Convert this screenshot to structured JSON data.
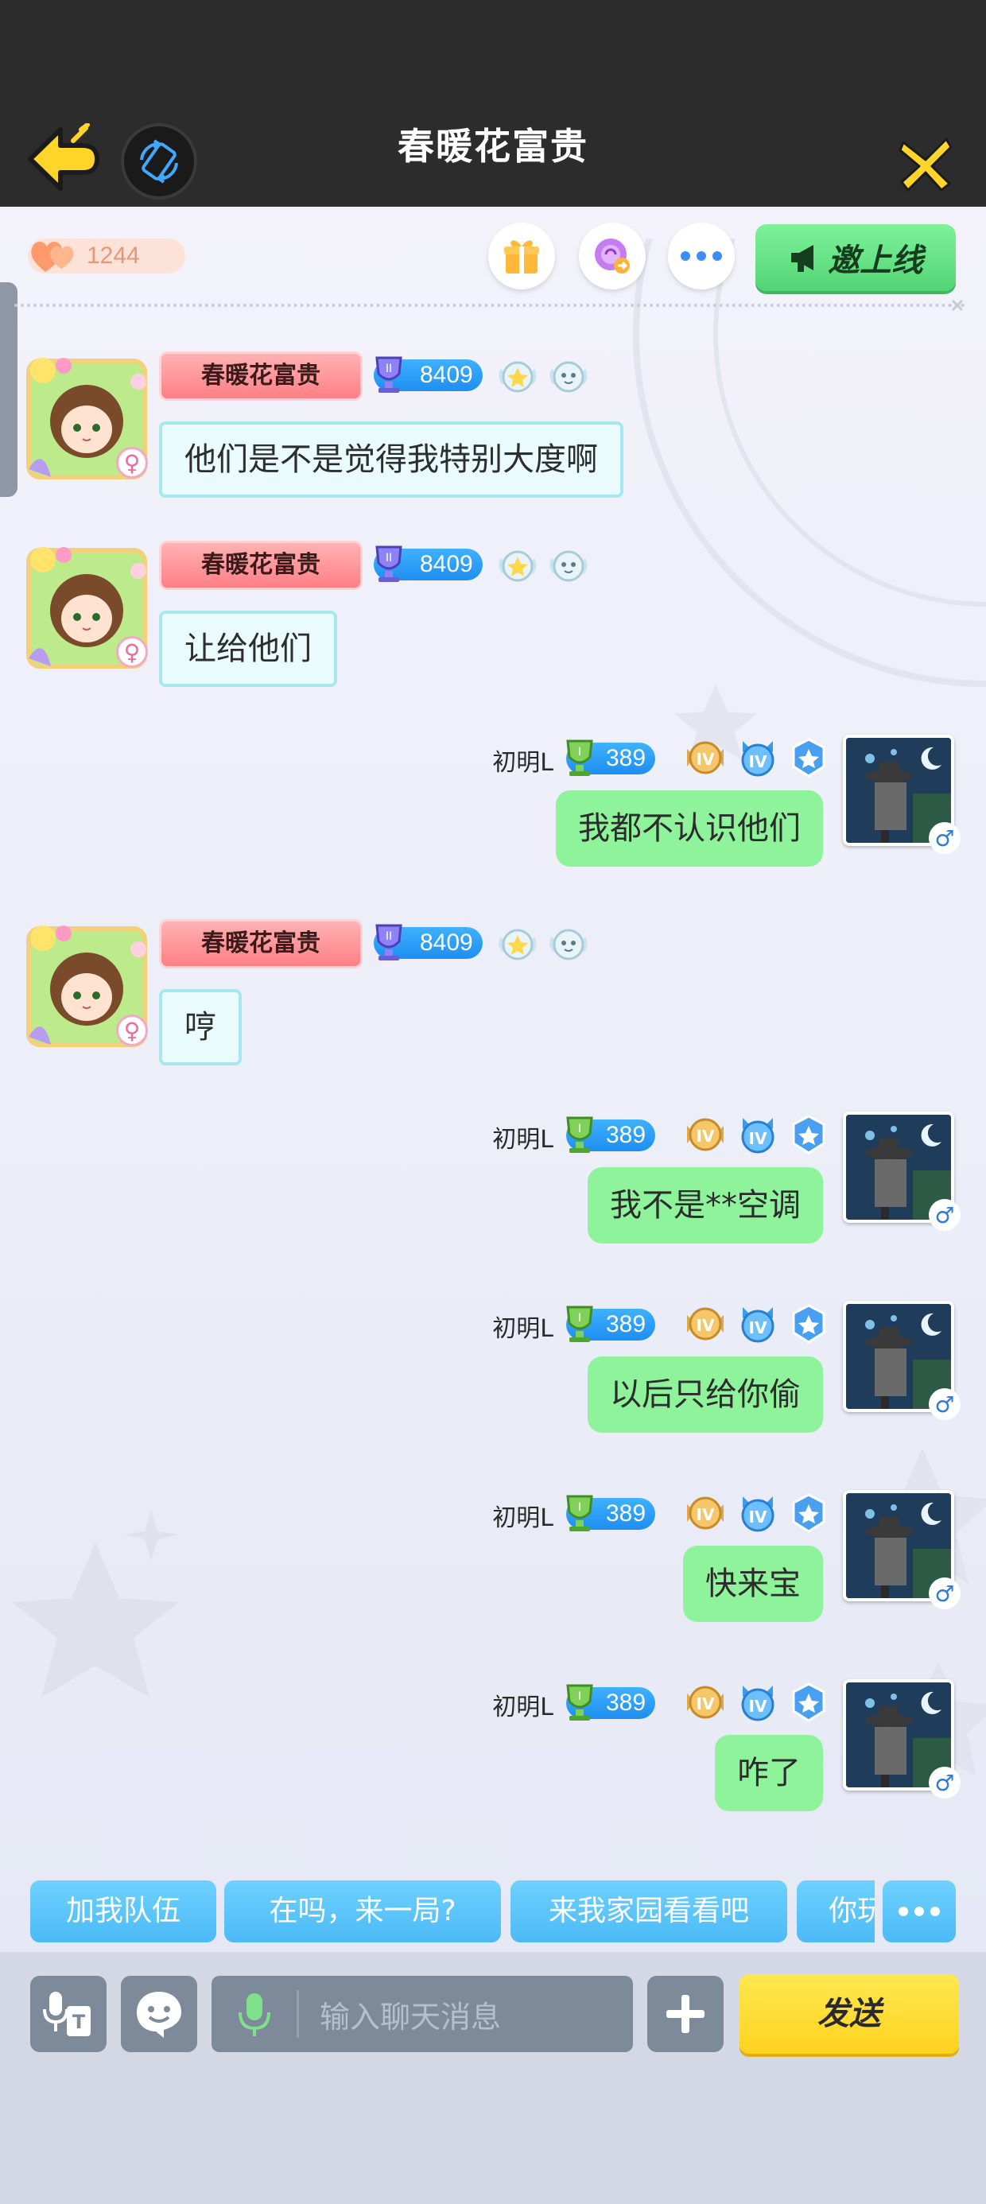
{
  "header": {
    "title": "春暖花富贵"
  },
  "toolbar": {
    "hearts_count": "1244",
    "invite_label": "邀上线"
  },
  "messages": [
    {
      "side": "left",
      "user": "春暖花富贵",
      "level": "8409",
      "text": "他们是不是觉得我特别大度啊"
    },
    {
      "side": "left",
      "user": "春暖花富贵",
      "level": "8409",
      "text": "让给他们"
    },
    {
      "side": "right",
      "user": "初明L",
      "level": "389",
      "text": "我都不认识他们"
    },
    {
      "side": "left",
      "user": "春暖花富贵",
      "level": "8409",
      "text": "哼"
    },
    {
      "side": "right",
      "user": "初明L",
      "level": "389",
      "text": "我不是**空调"
    },
    {
      "side": "right",
      "user": "初明L",
      "level": "389",
      "text": "以后只给你偷"
    },
    {
      "side": "right",
      "user": "初明L",
      "level": "389",
      "text": "快来宝"
    },
    {
      "side": "right",
      "user": "初明L",
      "level": "389",
      "text": "咋了"
    }
  ],
  "badges": {
    "rank_roman": "IV",
    "female_symbol": "♀",
    "male_symbol": "♂"
  },
  "quick_replies": [
    "加我队伍",
    "在吗，来一局?",
    "来我家园看看吧",
    "你玩"
  ],
  "input": {
    "placeholder": "输入聊天消息",
    "send_label": "发送"
  },
  "colors": {
    "header_bg": "#2c2c2c",
    "accent_green": "#8ef39a",
    "accent_blue": "#4cbaf6",
    "send_yellow": "#ffd21f"
  }
}
